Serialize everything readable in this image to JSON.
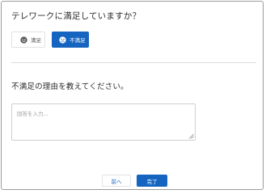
{
  "questions": {
    "telework": {
      "text": "テレワークに満足していますか？",
      "options": [
        {
          "label": "満足",
          "icon": "smile-face-icon",
          "selected": false
        },
        {
          "label": "不満足",
          "icon": "frown-face-icon",
          "selected": true
        }
      ]
    },
    "reason": {
      "text": "不満足の理由を教えてください。",
      "placeholder": "回答を入力...",
      "value": ""
    }
  },
  "navigation": {
    "prev_label": "前へ",
    "done_label": "完了"
  },
  "colors": {
    "accent": "#1565c0",
    "border": "#cfcfcf",
    "text": "#2b2b2b"
  }
}
